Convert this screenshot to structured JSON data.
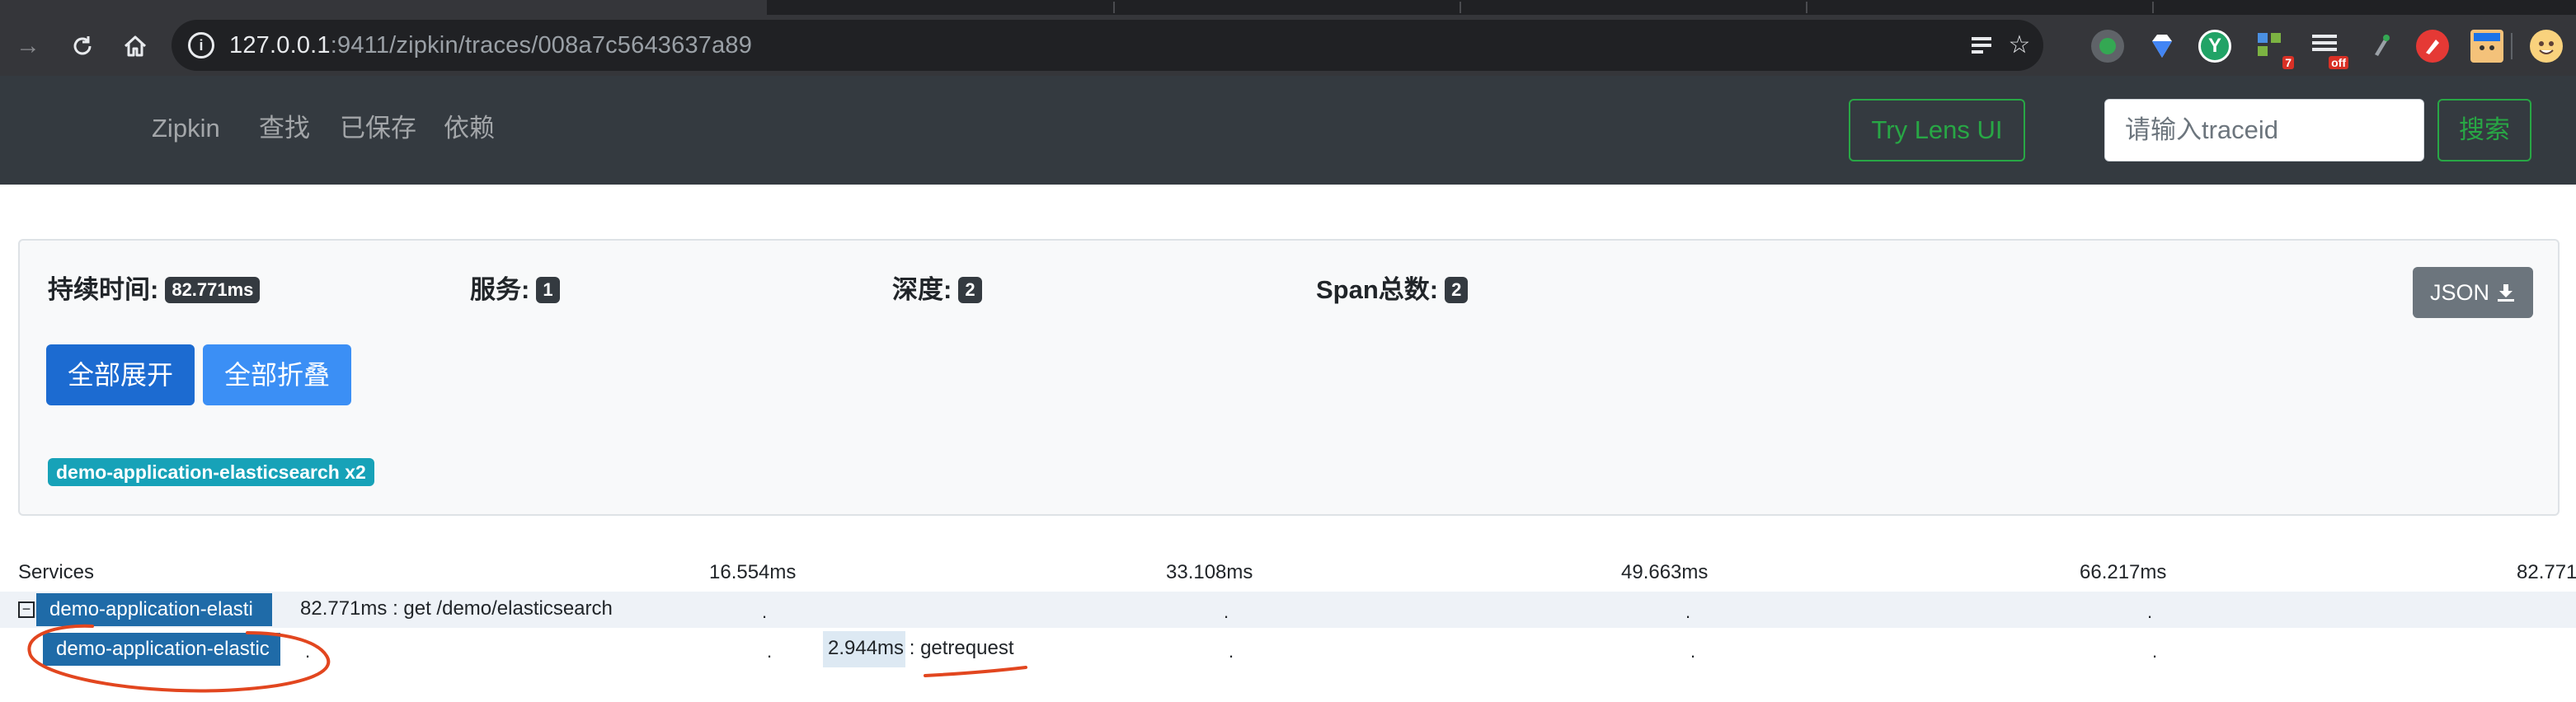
{
  "browser": {
    "url_host": "127.0.0.1",
    "url_rest": ":9411/zipkin/traces/008a7c5643637a89",
    "back_icon": "arrow-left-icon",
    "reload_icon": "reload-icon",
    "home_icon": "home-icon",
    "ext_badges": {
      "seven": "7",
      "off": "off"
    }
  },
  "navbar": {
    "brand": "Zipkin",
    "links": [
      "查找",
      "已保存",
      "依赖"
    ],
    "lens_button": "Try Lens UI",
    "trace_placeholder": "请输入traceid",
    "search_button": "搜索"
  },
  "summary": {
    "duration_label": "持续时间:",
    "duration_value": "82.771ms",
    "services_label": "服务:",
    "services_value": "1",
    "depth_label": "深度:",
    "depth_value": "2",
    "spans_label": "Span总数:",
    "spans_value": "2",
    "json_button": "JSON",
    "expand_all": "全部展开",
    "collapse_all": "全部折叠",
    "service_badge": "demo-application-elasticsearch x2"
  },
  "timeline": {
    "header": "Services",
    "ticks": [
      "16.554ms",
      "33.108ms",
      "49.663ms",
      "66.217ms",
      "82.771"
    ],
    "toggle_symbol": "⊟",
    "rows": [
      {
        "service": "demo-application-elasti",
        "label": "82.771ms : get /demo/elasticsearch"
      },
      {
        "service": "demo-application-elastic",
        "duration": "2.944ms",
        "name": " : getrequest"
      }
    ]
  },
  "colors": {
    "navbar_bg": "#343a40",
    "accent_green": "#28a745",
    "primary_blue": "#007bff",
    "service_bar": "#1f6ba8",
    "badge_teal": "#17a2b8",
    "annotation_red": "#e2461f"
  }
}
